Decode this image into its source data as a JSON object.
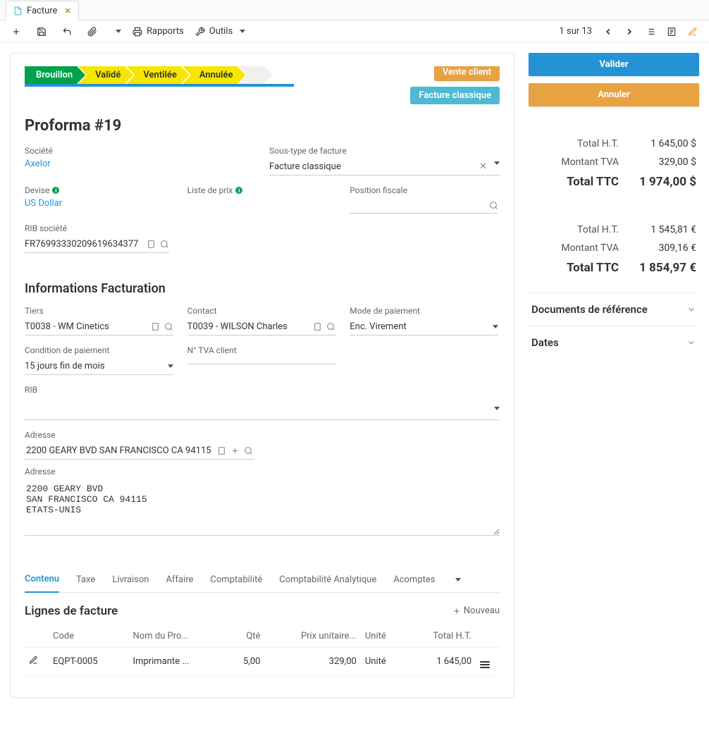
{
  "tab": {
    "label": "Facture",
    "close_tooltip": "Fermer"
  },
  "toolbar": {
    "reports": "Rapports",
    "tools": "Outils",
    "pager": "1 sur 13"
  },
  "status": {
    "s1": "Brouillon",
    "s2": "Validé",
    "s3": "Ventilée",
    "s4": "Annulée"
  },
  "badges": {
    "b1": "Vente client",
    "b2": "Facture classique"
  },
  "title": "Proforma #19",
  "fields": {
    "company_lbl": "Société",
    "company_val": "Axelor",
    "currency_lbl": "Devise",
    "currency_val": "US Dollar",
    "pricelist_lbl": "Liste de prix",
    "subtype_lbl": "Sous-type de facture",
    "subtype_val": "Facture classique",
    "fiscal_lbl": "Position fiscale",
    "ribsoc_lbl": "RIB société",
    "ribsoc_val": "FR76993330209619634377"
  },
  "billing": {
    "heading": "Informations Facturation",
    "partner_lbl": "Tiers",
    "partner_val": "T0038 - WM Cinetics",
    "contact_lbl": "Contact",
    "contact_val": "T0039 - WILSON Charles",
    "paymode_lbl": "Mode de paiement",
    "paymode_val": "Enc. Virement",
    "paycond_lbl": "Condition de paiement",
    "paycond_val": "15 jours fin de mois",
    "vatnum_lbl": "N° TVA client",
    "rib_lbl": "RIB",
    "addr1_lbl": "Adresse",
    "addr1_val": "2200 GEARY BVD SAN FRANCISCO CA 94115",
    "addr2_lbl": "Adresse",
    "addr2_val": "2200 GEARY BVD\nSAN FRANCISCO CA 94115\nETATS-UNIS"
  },
  "tabs": {
    "t1": "Contenu",
    "t2": "Taxe",
    "t3": "Livraison",
    "t4": "Affaire",
    "t5": "Comptabilité",
    "t6": "Comptabilité Analytique",
    "t7": "Acomptes"
  },
  "lines": {
    "heading": "Lignes de facture",
    "new": "Nouveau",
    "cols": {
      "code": "Code",
      "name": "Nom du Pro...",
      "qty": "Qté",
      "price": "Prix unitaire...",
      "unit": "Unité",
      "total": "Total H.T."
    },
    "row": {
      "code": "EQPT-0005",
      "name": "Imprimante ...",
      "qty": "5,00",
      "price": "329,00",
      "unit": "Unité",
      "total": "1 645,00"
    }
  },
  "actions": {
    "validate": "Valider",
    "cancel": "Annuler"
  },
  "totals_usd": {
    "ht_lbl": "Total H.T.",
    "ht_val": "1 645,00 $",
    "tva_lbl": "Montant TVA",
    "tva_val": "329,00 $",
    "ttc_lbl": "Total TTC",
    "ttc_val": "1 974,00 $"
  },
  "totals_eur": {
    "ht_lbl": "Total H.T.",
    "ht_val": "1 545,81 €",
    "tva_lbl": "Montant TVA",
    "tva_val": "309,16 €",
    "ttc_lbl": "Total TTC",
    "ttc_val": "1 854,97 €"
  },
  "panels": {
    "docs": "Documents de référence",
    "dates": "Dates"
  }
}
